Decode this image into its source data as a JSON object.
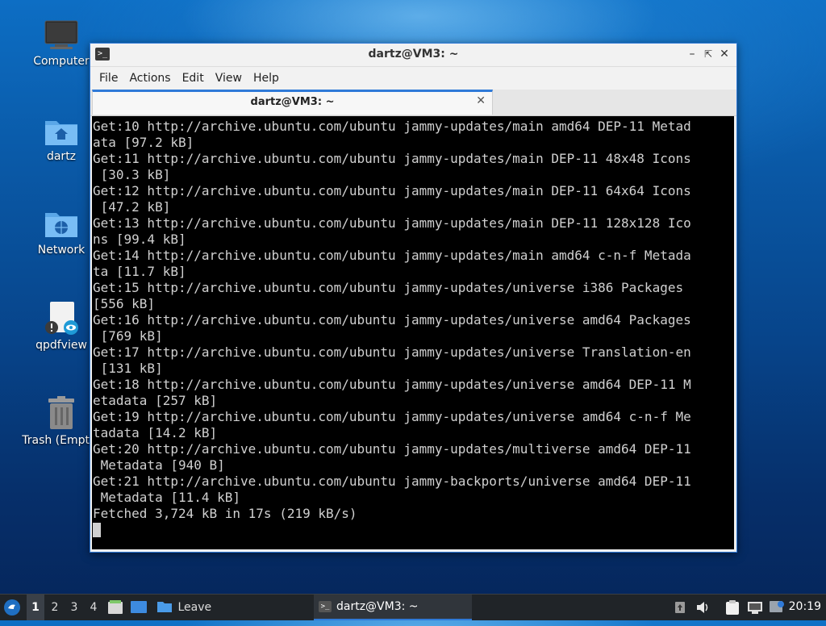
{
  "desktop": {
    "icons": [
      {
        "label": "Computer"
      },
      {
        "label": "dartz"
      },
      {
        "label": "Network"
      },
      {
        "label": "qpdfview"
      },
      {
        "label": "Trash (Empty)"
      }
    ]
  },
  "window": {
    "title": "dartz@VM3: ~",
    "icon": "terminal-icon",
    "menu": [
      "File",
      "Actions",
      "Edit",
      "View",
      "Help"
    ],
    "tab": {
      "label": "dartz@VM3: ~"
    },
    "terminal_lines": [
      "Get:10 http://archive.ubuntu.com/ubuntu jammy-updates/main amd64 DEP-11 Metad",
      "ata [97.2 kB]",
      "Get:11 http://archive.ubuntu.com/ubuntu jammy-updates/main DEP-11 48x48 Icons",
      " [30.3 kB]",
      "Get:12 http://archive.ubuntu.com/ubuntu jammy-updates/main DEP-11 64x64 Icons",
      " [47.2 kB]",
      "Get:13 http://archive.ubuntu.com/ubuntu jammy-updates/main DEP-11 128x128 Ico",
      "ns [99.4 kB]",
      "Get:14 http://archive.ubuntu.com/ubuntu jammy-updates/main amd64 c-n-f Metada",
      "ta [11.7 kB]",
      "Get:15 http://archive.ubuntu.com/ubuntu jammy-updates/universe i386 Packages",
      "[556 kB]",
      "Get:16 http://archive.ubuntu.com/ubuntu jammy-updates/universe amd64 Packages",
      " [769 kB]",
      "Get:17 http://archive.ubuntu.com/ubuntu jammy-updates/universe Translation-en",
      " [131 kB]",
      "Get:18 http://archive.ubuntu.com/ubuntu jammy-updates/universe amd64 DEP-11 M",
      "etadata [257 kB]",
      "Get:19 http://archive.ubuntu.com/ubuntu jammy-updates/universe amd64 c-n-f Me",
      "tadata [14.2 kB]",
      "Get:20 http://archive.ubuntu.com/ubuntu jammy-updates/multiverse amd64 DEP-11",
      " Metadata [940 B]",
      "Get:21 http://archive.ubuntu.com/ubuntu jammy-backports/universe amd64 DEP-11",
      " Metadata [11.4 kB]",
      "Fetched 3,724 kB in 17s (219 kB/s)"
    ]
  },
  "taskbar": {
    "workspaces": [
      "1",
      "2",
      "3",
      "4"
    ],
    "active_workspace": "1",
    "quick_launch_label": "Leave",
    "task_label": "dartz@VM3: ~",
    "clock": "20:19"
  },
  "colors": {
    "accent": "#2f7ad8",
    "terminal_bg": "#000000",
    "terminal_fg": "#d0d0d0",
    "taskbar_bg": "#202428"
  }
}
